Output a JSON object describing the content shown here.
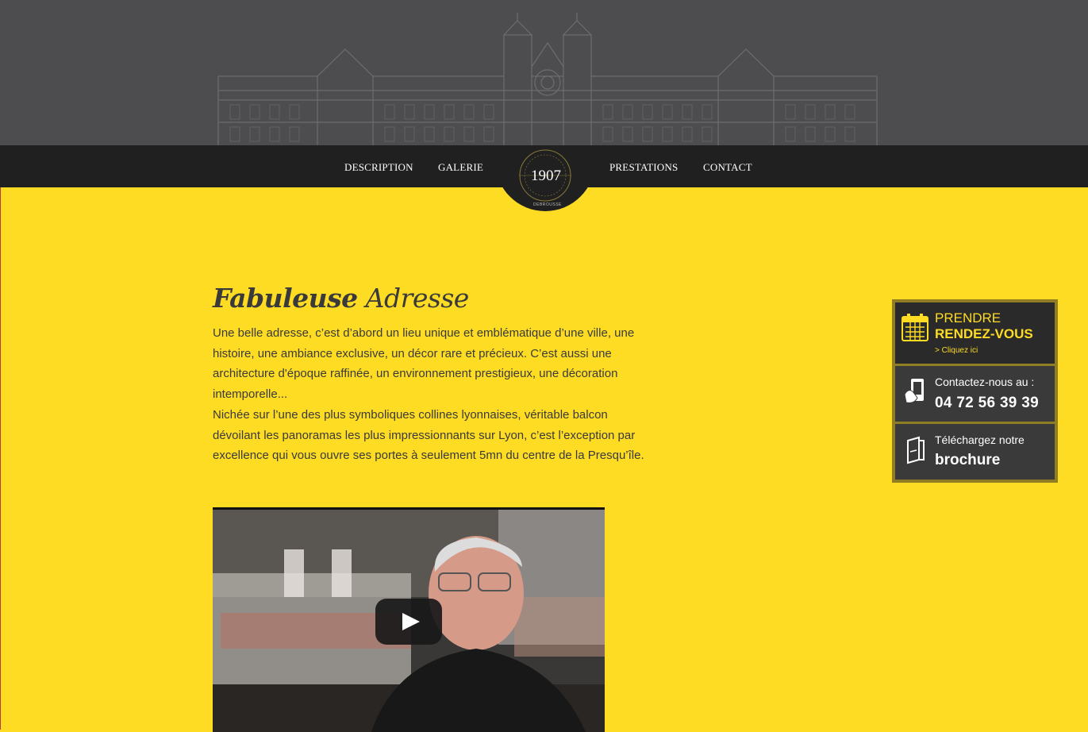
{
  "nav": {
    "left": [
      {
        "label": "DESCRIPTION"
      },
      {
        "label": "GALERIE"
      }
    ],
    "right": [
      {
        "label": "PRESTATIONS"
      },
      {
        "label": "CONTACT"
      }
    ],
    "logo_year": "1907",
    "logo_sub": "DEBROUSSE"
  },
  "main": {
    "title_bold": "Fabuleuse",
    "title_rest": "Adresse",
    "para1": "Une belle adresse, c’est d’abord un lieu unique et emblématique d’une ville, une histoire, une ambiance exclusive, un décor rare et précieux. C’est aussi une architecture d'époque raffinée, un environnement prestigieux, une décoration intemporelle...",
    "para2": "Nichée sur l’une des plus symboliques collines lyonnaises, véritable balcon dévoilant les panoramas les plus impressionnants sur Lyon, c’est l’exception par excellence qui vous ouvre ses portes à seulement 5mn du centre de la Presqu’île."
  },
  "sidebar": {
    "rdv_line1": "PRENDRE",
    "rdv_line2": "RENDEZ-VOUS",
    "rdv_link": "> Cliquez ici",
    "contact_label": "Contactez-nous au :",
    "phone": "04 72 56 39 39",
    "brochure_label": "Téléchargez notre",
    "brochure_word": "brochure"
  },
  "colors": {
    "accent": "#fedc24",
    "dark": "#202020",
    "hero": "#4d4d4f"
  },
  "icons": [
    "calendar-icon",
    "phone-icon",
    "brochure-icon",
    "play-icon"
  ]
}
